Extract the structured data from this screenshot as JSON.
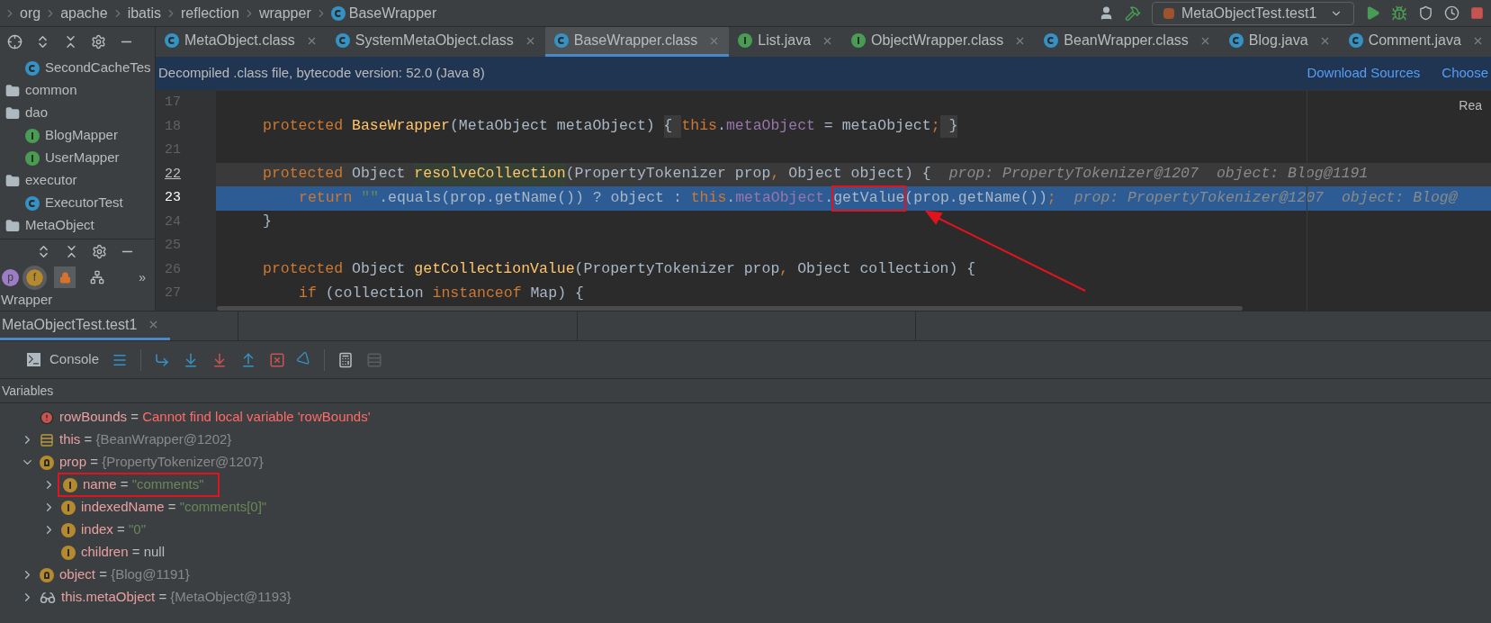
{
  "breadcrumbs": [
    {
      "label": "org",
      "kind": "package"
    },
    {
      "label": "apache",
      "kind": "package"
    },
    {
      "label": "ibatis",
      "kind": "package"
    },
    {
      "label": "reflection",
      "kind": "package"
    },
    {
      "label": "wrapper",
      "kind": "package"
    },
    {
      "label": "BaseWrapper",
      "kind": "class"
    }
  ],
  "run_config": {
    "label": "MetaObjectTest.test1"
  },
  "tabs": [
    {
      "label": "MetaObject.class",
      "kind": "class",
      "selected": false
    },
    {
      "label": "SystemMetaObject.class",
      "kind": "class",
      "selected": false
    },
    {
      "label": "BaseWrapper.class",
      "kind": "class",
      "selected": true
    },
    {
      "label": "List.java",
      "kind": "interface",
      "selected": false
    },
    {
      "label": "ObjectWrapper.class",
      "kind": "interface",
      "selected": false
    },
    {
      "label": "BeanWrapper.class",
      "kind": "class",
      "selected": false
    },
    {
      "label": "Blog.java",
      "kind": "class",
      "selected": false
    },
    {
      "label": "Comment.java",
      "kind": "class",
      "selected": false
    }
  ],
  "notice": {
    "text": "Decompiled .class file, bytecode version: 52.0 (Java 8)",
    "links": [
      "Download Sources",
      "Choose"
    ]
  },
  "reader_mode": "Rea",
  "project_tree": [
    {
      "label": "SecondCacheTes",
      "kind": "test"
    },
    {
      "label": "common",
      "kind": "folder"
    },
    {
      "label": "dao",
      "kind": "folder"
    },
    {
      "label": "BlogMapper",
      "kind": "interface"
    },
    {
      "label": "UserMapper",
      "kind": "interface"
    },
    {
      "label": "executor",
      "kind": "folder"
    },
    {
      "label": "ExecutorTest",
      "kind": "test"
    },
    {
      "label": "MetaObject",
      "kind": "folder"
    }
  ],
  "structure": {
    "filters": [
      {
        "label": "p",
        "kind": "property"
      },
      {
        "label": "f",
        "kind": "field"
      }
    ],
    "more": "»",
    "item": "Wrapper"
  },
  "code": [
    {
      "number": "17",
      "current": false,
      "selected": false
    },
    {
      "number": "18",
      "current": false,
      "selected": false,
      "indented": false,
      "segments": [
        {
          "kind": "kw",
          "text": "protected "
        },
        {
          "kind": "method",
          "text": "BaseWrapper"
        },
        {
          "kind": "plain",
          "text": "(MetaObject metaObject) "
        },
        {
          "kind": "fold",
          "text": "{ "
        },
        {
          "kind": "kw",
          "text": "this"
        },
        {
          "kind": "plain",
          "text": "."
        },
        {
          "kind": "field",
          "text": "metaObject"
        },
        {
          "kind": "plain",
          "text": " = metaObject"
        },
        {
          "kind": "kw",
          "text": ";"
        },
        {
          "kind": "fold",
          "text": " }"
        }
      ]
    },
    {
      "number": "21",
      "current": false,
      "selected": false
    },
    {
      "number": "22",
      "current": true,
      "selected": false,
      "indented": false,
      "segments": [
        {
          "kind": "kw",
          "text": "protected "
        },
        {
          "kind": "plain",
          "text": "Object "
        },
        {
          "kind": "method-usage",
          "text": "resolveCollection"
        },
        {
          "kind": "plain",
          "text": "(PropertyTokenizer prop"
        },
        {
          "kind": "kw",
          "text": ","
        },
        {
          "kind": "plain",
          "text": " Object object) {"
        },
        {
          "kind": "hint",
          "text": "prop: PropertyTokenizer@1207"
        },
        {
          "kind": "hint",
          "text": "object: Blog@1191"
        }
      ]
    },
    {
      "number": "23",
      "current": false,
      "selected": true,
      "indented": true,
      "segments": [
        {
          "kind": "kw",
          "text": "return "
        },
        {
          "kind": "string",
          "text": "\"\""
        },
        {
          "kind": "plain",
          "text": ".equals(prop.getName()) ? object : "
        },
        {
          "kind": "kw",
          "text": "this"
        },
        {
          "kind": "plain",
          "text": "."
        },
        {
          "kind": "field",
          "text": "metaObject"
        },
        {
          "kind": "plain",
          "text": "."
        },
        {
          "kind": "marked",
          "text": "getValue"
        },
        {
          "kind": "plain",
          "text": "(prop.getName())"
        },
        {
          "kind": "kw",
          "text": ";"
        },
        {
          "kind": "hint",
          "text": "prop: PropertyTokenizer@1207"
        },
        {
          "kind": "hint",
          "text": "object: Blog@"
        }
      ]
    },
    {
      "number": "24",
      "current": false,
      "selected": false,
      "indented": false,
      "segments": [
        {
          "kind": "plain",
          "text": "}"
        }
      ]
    },
    {
      "number": "25",
      "current": false,
      "selected": false
    },
    {
      "number": "26",
      "current": false,
      "selected": false,
      "indented": false,
      "segments": [
        {
          "kind": "kw",
          "text": "protected "
        },
        {
          "kind": "plain",
          "text": "Object "
        },
        {
          "kind": "method",
          "text": "getCollectionValue"
        },
        {
          "kind": "plain",
          "text": "(PropertyTokenizer prop"
        },
        {
          "kind": "kw",
          "text": ","
        },
        {
          "kind": "plain",
          "text": " Object collection) {"
        }
      ]
    },
    {
      "number": "27",
      "current": false,
      "selected": false,
      "indented": true,
      "segments": [
        {
          "kind": "kw",
          "text": "if "
        },
        {
          "kind": "plain",
          "text": "(collection "
        },
        {
          "kind": "kw",
          "text": "instanceof "
        },
        {
          "kind": "plain",
          "text": "Map) {"
        }
      ]
    }
  ],
  "debug": {
    "session_tab": {
      "label": "MetaObjectTest.test1",
      "selected": true
    },
    "console_tab": "Console",
    "variables_title": "Variables",
    "variables": [
      {
        "kind": "error",
        "name": "rowBounds",
        "operator": "=",
        "value": {
          "kind": "error",
          "text": "Cannot find local variable 'rowBounds'"
        },
        "expandable": false,
        "marked": false
      },
      {
        "kind": "object",
        "name": "this",
        "operator": "=",
        "value": {
          "kind": "object",
          "text": "{BeanWrapper@1202}"
        },
        "expandable": true,
        "expanded": false,
        "marked": false
      },
      {
        "kind": "param",
        "name": "prop",
        "operator": "=",
        "value": {
          "kind": "object",
          "text": "{PropertyTokenizer@1207}"
        },
        "expandable": true,
        "expanded": true,
        "marked": false,
        "children": [
          {
            "kind": "field",
            "name": "name",
            "operator": "=",
            "value": {
              "kind": "string",
              "text": "\"comments\""
            },
            "expandable": true,
            "expanded": false,
            "marked": true
          },
          {
            "kind": "field",
            "name": "indexedName",
            "operator": "=",
            "value": {
              "kind": "string",
              "text": "\"comments[0]\""
            },
            "expandable": true,
            "expanded": false,
            "marked": false
          },
          {
            "kind": "field",
            "name": "index",
            "operator": "=",
            "value": {
              "kind": "string",
              "text": "\"0\""
            },
            "expandable": true,
            "expanded": false,
            "marked": false
          },
          {
            "kind": "field",
            "name": "children",
            "operator": "=",
            "value": {
              "kind": "plain",
              "text": "null"
            },
            "expandable": false,
            "marked": false
          }
        ]
      },
      {
        "kind": "param",
        "name": "object",
        "operator": "=",
        "value": {
          "kind": "object",
          "text": "{Blog@1191}"
        },
        "expandable": true,
        "expanded": false,
        "marked": false
      },
      {
        "kind": "watch",
        "name": "this.metaObject",
        "operator": "=",
        "value": {
          "kind": "object",
          "text": "{MetaObject@1193}"
        },
        "expandable": true,
        "expanded": false,
        "marked": false
      }
    ]
  }
}
